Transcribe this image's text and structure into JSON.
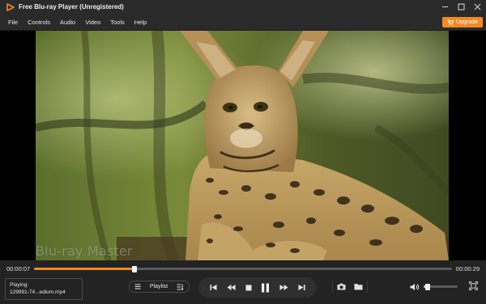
{
  "window": {
    "title": "Free Blu-ray Player (Unregistered)"
  },
  "menu": {
    "items": [
      "File",
      "Controls",
      "Audio",
      "Video",
      "Tools",
      "Help"
    ],
    "upgrade_label": "Upgrade"
  },
  "video": {
    "watermark": "Blu-ray Master"
  },
  "playback": {
    "elapsed": "00:00:07",
    "total": "00:00:29",
    "progress": 0.24
  },
  "now_playing": {
    "label": "Playing:",
    "file": "129991-74...edium.mp4"
  },
  "playlist": {
    "label": "Playlist"
  },
  "volume": {
    "level": 0.12
  },
  "colors": {
    "accent": "#f08a24",
    "background": "#232323",
    "bar": "#2a2a2a"
  },
  "icons": [
    "play-logo-icon",
    "minimize-icon",
    "maximize-icon",
    "close-icon",
    "upgrade-cart-icon",
    "playlist-menu-icon",
    "playlist-edit-icon",
    "skip-previous-icon",
    "rewind-icon",
    "stop-icon",
    "pause-icon",
    "fast-forward-icon",
    "skip-next-icon",
    "snapshot-icon",
    "folder-icon",
    "volume-icon",
    "fullscreen-icon"
  ]
}
